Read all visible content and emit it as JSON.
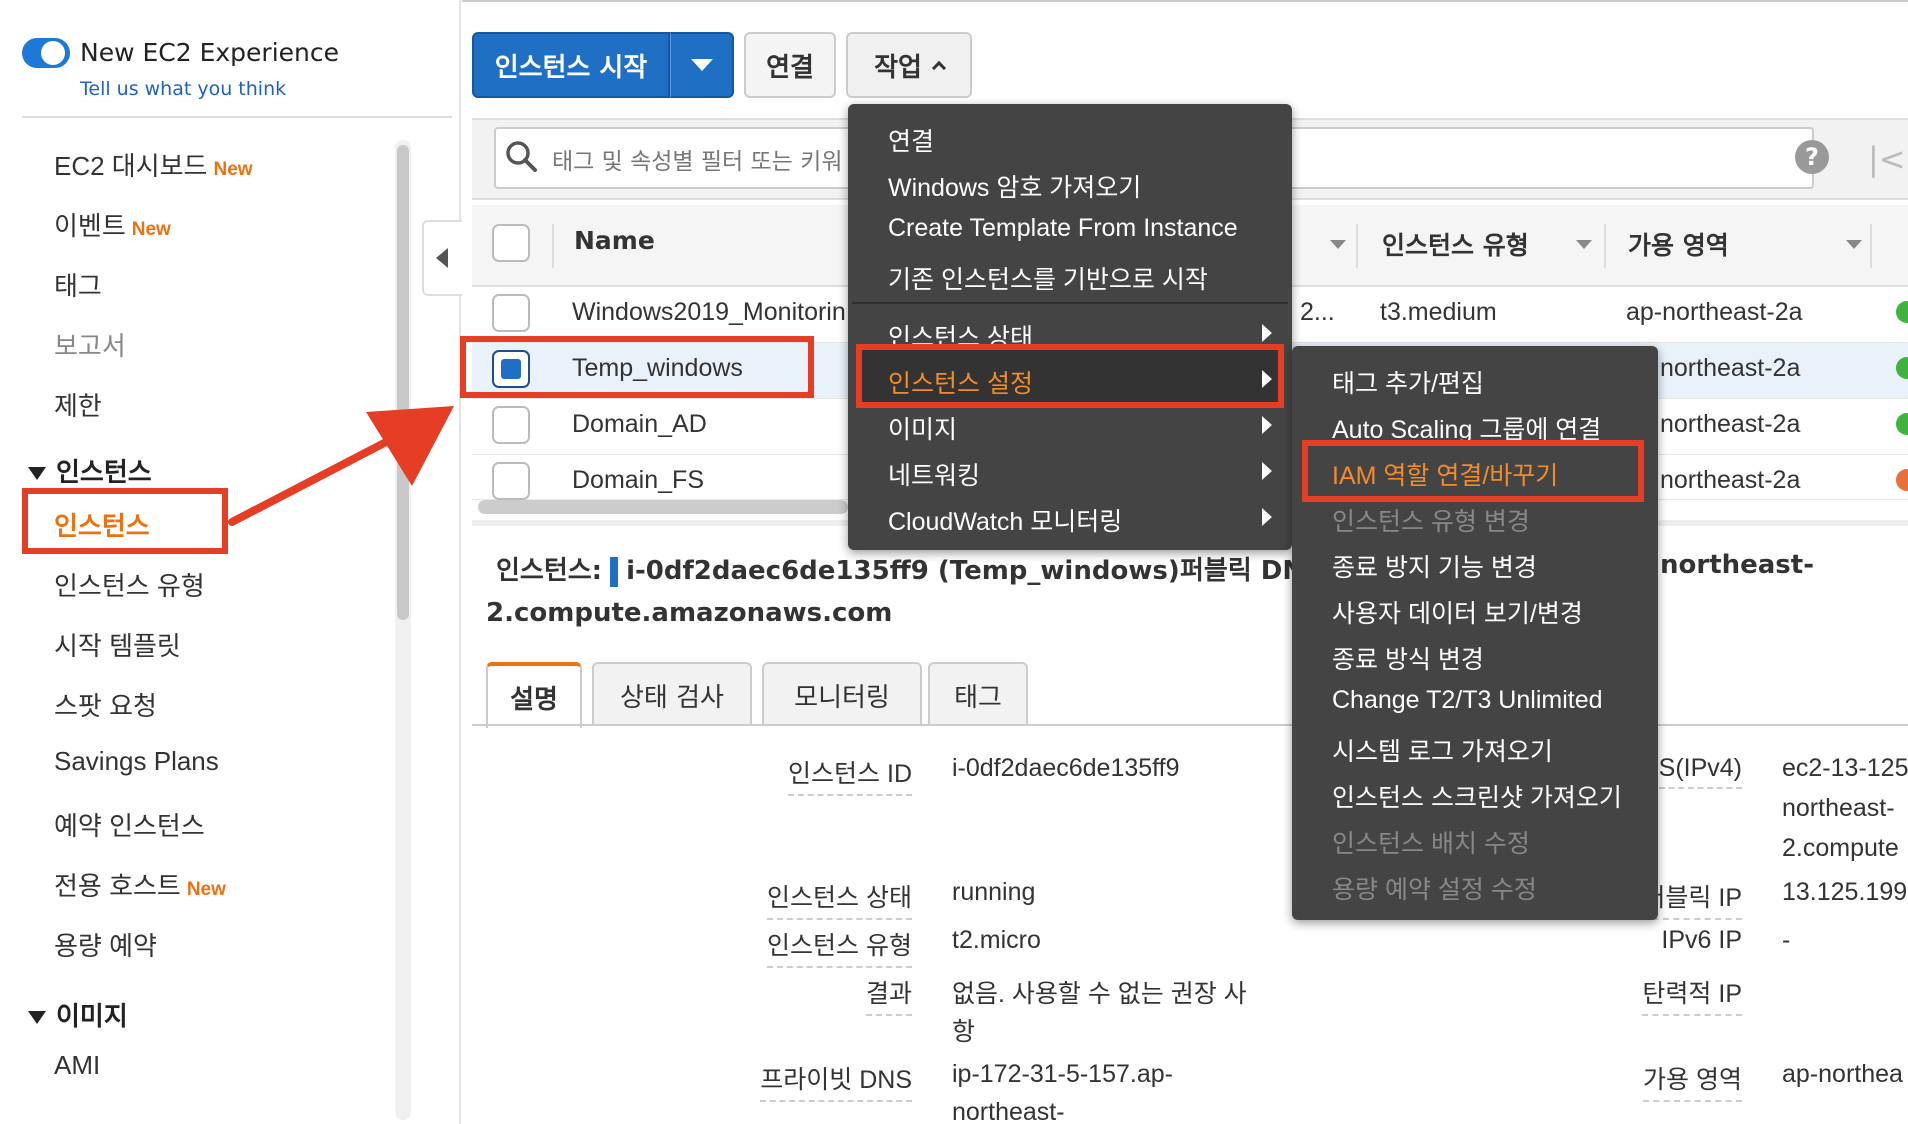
{
  "sidebar": {
    "experience_title": "New EC2 Experience",
    "experience_link": "Tell us what you think",
    "items": [
      {
        "label": "EC2 대시보드",
        "badge": "New"
      },
      {
        "label": "이벤트",
        "badge": "New"
      },
      {
        "label": "태그"
      },
      {
        "label": "보고서"
      },
      {
        "label": "제한"
      }
    ],
    "section_instances": "인스턴스",
    "instances_items": [
      "인스턴스",
      "인스턴스 유형",
      "시작 템플릿",
      "스팟 요청",
      "Savings Plans",
      "예약 인스턴스",
      "전용 호스트",
      "용량 예약"
    ],
    "dedicated_badge": "New",
    "section_images": "이미지",
    "images_items": [
      "AMI"
    ]
  },
  "toolbar": {
    "launch_label": "인스턴스 시작",
    "connect_label": "연결",
    "actions_label": "작업"
  },
  "filter": {
    "placeholder": "태그 및 속성별 필터 또는 키워"
  },
  "table": {
    "columns": [
      "Name",
      "인스턴스 유형",
      "가용 영역"
    ],
    "rows": [
      {
        "name": "Windows2019_Monitorin",
        "id_partial": "2...",
        "type": "t3.medium",
        "az": "ap-northeast-2a",
        "status_color": "#3fb23f"
      },
      {
        "name": "Temp_windows",
        "az": "northeast-2a",
        "status_color": "#3fb23f"
      },
      {
        "name": "Domain_AD",
        "az": "northeast-2a",
        "status_color": "#3fb23f"
      },
      {
        "name": "Domain_FS",
        "az": "northeast-2a",
        "status_color": "#e8703a"
      }
    ]
  },
  "detail": {
    "title_prefix": "인스턴스:",
    "title_value": "i-0df2daec6de135ff9 (Temp_windows)",
    "public_dns_label": "퍼블릭 DN",
    "public_dns_partial": "northeast-",
    "dns_line2": "2.compute.amazonaws.com",
    "tabs": [
      "설명",
      "상태 검사",
      "모니터링",
      "태그"
    ],
    "fields": [
      {
        "label": "인스턴스 ID",
        "value": "i-0df2daec6de135ff9"
      },
      {
        "label": "인스턴스 상태",
        "value": "running"
      },
      {
        "label": "인스턴스 유형",
        "value": "t2.micro"
      },
      {
        "label": "결과",
        "value": "없음. 사용할 수 없는 권장 사",
        "value2": "항"
      },
      {
        "label": "프라이빗 DNS",
        "value": "ip-172-31-5-157.ap-",
        "value2": "northeast-"
      }
    ],
    "right_fields": [
      {
        "label": "S(IPv4)",
        "value": "ec2-13-125",
        "value2": "northeast-",
        "value3": "2.compute"
      },
      {
        "label": "퍼블릭 IP",
        "value": "13.125.199"
      },
      {
        "label": "IPv6 IP",
        "value": "-"
      },
      {
        "label": "탄력적 IP",
        "value": ""
      },
      {
        "label": "가용 영역",
        "value": "ap-northea"
      }
    ]
  },
  "actions_menu": {
    "items": [
      "연결",
      "Windows 암호 가져오기",
      "Create Template From Instance",
      "기존 인스턴스를 기반으로 시작"
    ],
    "submenus": [
      "인스턴스 상태",
      "인스턴스 설정",
      "이미지",
      "네트워킹",
      "CloudWatch 모니터링"
    ]
  },
  "settings_menu": {
    "items": [
      {
        "label": "태그 추가/편집",
        "state": "enabled"
      },
      {
        "label": "Auto Scaling 그룹에 연결",
        "state": "enabled"
      },
      {
        "label": "IAM 역할 연결/바꾸기",
        "state": "highlighted"
      },
      {
        "label": "인스턴스 유형 변경",
        "state": "disabled"
      },
      {
        "label": "종료 방지 기능 변경",
        "state": "enabled"
      },
      {
        "label": "사용자 데이터 보기/변경",
        "state": "enabled"
      },
      {
        "label": "종료 방식 변경",
        "state": "enabled"
      },
      {
        "label": "Change T2/T3 Unlimited",
        "state": "enabled"
      },
      {
        "label": "시스템 로그 가져오기",
        "state": "enabled"
      },
      {
        "label": "인스턴스 스크린샷 가져오기",
        "state": "enabled"
      },
      {
        "label": "인스턴스 배치 수정",
        "state": "disabled"
      },
      {
        "label": "용량 예약 설정 수정",
        "state": "disabled"
      }
    ]
  },
  "colors": {
    "accent_orange": "#ec7211",
    "primary_blue": "#1f6fc4",
    "annotation_red": "#e63e25",
    "menu_bg": "#444444"
  }
}
